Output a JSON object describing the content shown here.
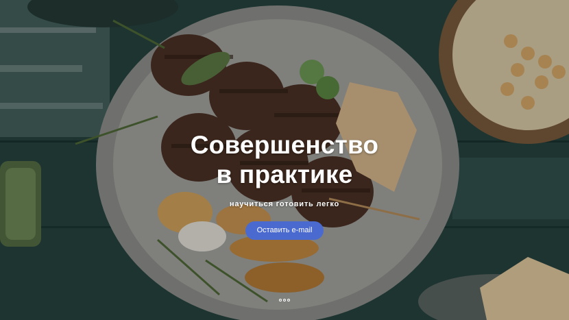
{
  "hero": {
    "title_line1": "Совершенство",
    "title_line2": "в практике",
    "subtitle": "научиться готовить легко",
    "cta_label": "Оставить e-mail",
    "background_image": "food-plate-photo",
    "accent_color": "#4a6ad0",
    "slider_dots": 3
  }
}
